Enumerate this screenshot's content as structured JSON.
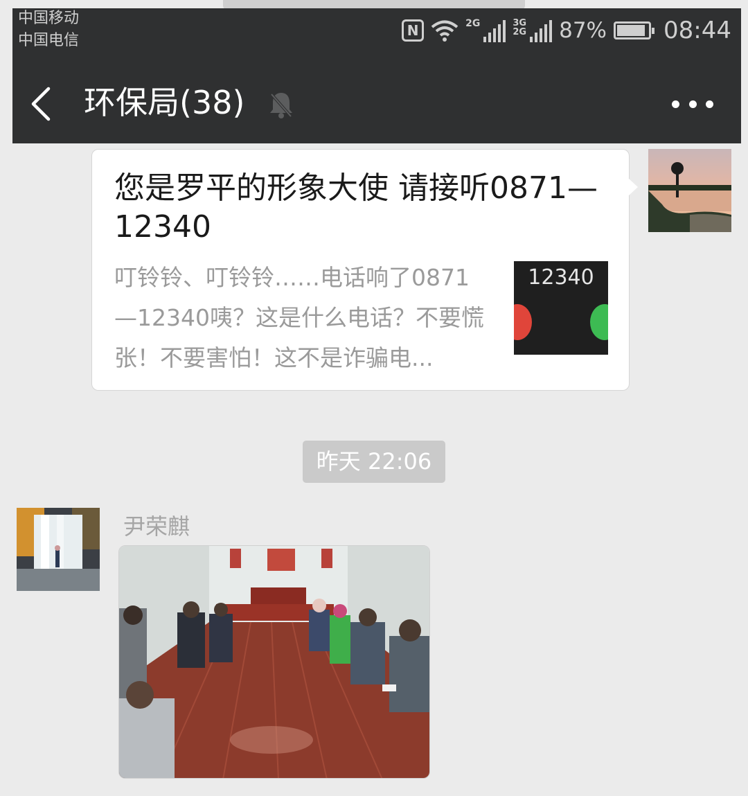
{
  "status_bar": {
    "carrier_1": "中国移动",
    "carrier_2": "中国电信",
    "nfc_label": "N",
    "sim1_type": "2G",
    "sim2_type_top": "3G",
    "sim2_type_bottom": "2G",
    "battery_percent": "87%",
    "time": "08:44"
  },
  "header": {
    "title": "环保局(38)"
  },
  "messages": {
    "link_card": {
      "title": "您是罗平的形象大使  请接听0871—12340",
      "description": "叮铃铃、叮铃铃……电话响了0871—12340咦？这是什么电话？不要慌张！不要害怕！这不是诈骗电...",
      "thumbnail_text": "12340"
    },
    "timestamp": "昨天 22:06",
    "incoming": {
      "sender_name": "尹荣麒"
    }
  },
  "colors": {
    "header_bg": "#2f3031",
    "chat_bg": "#ebebeb",
    "bubble_bg": "#ffffff",
    "time_pill_bg": "#cacaca"
  },
  "icons": {
    "back": "chevron-left-icon",
    "mute": "bell-off-icon",
    "more": "more-dots-icon",
    "wifi": "wifi-icon",
    "nfc": "nfc-icon",
    "battery": "battery-icon"
  }
}
